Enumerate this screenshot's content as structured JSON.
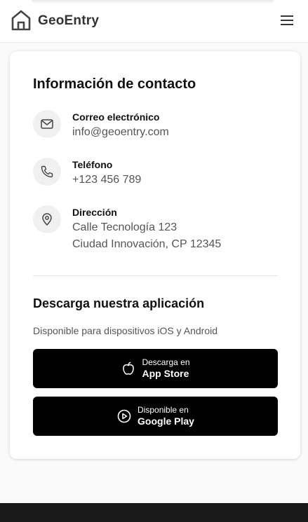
{
  "header": {
    "brand": "GeoEntry"
  },
  "contact": {
    "title": "Información de contacto",
    "email": {
      "label": "Correo electrónico",
      "value": "info@geoentry.com"
    },
    "phone": {
      "label": "Teléfono",
      "value": "+123 456 789"
    },
    "address": {
      "label": "Dirección",
      "line1": "Calle Tecnología 123",
      "line2": "Ciudad Innovación, CP 12345"
    }
  },
  "download": {
    "title": "Descarga nuestra aplicación",
    "description": "Disponible para dispositivos iOS y Android",
    "app_store": {
      "small": "Descarga en",
      "big": "App Store"
    },
    "google_play": {
      "small": "Disponible en",
      "big": "Google Play"
    }
  },
  "icons": {
    "logo": "house-icon",
    "menu": "hamburger-menu-icon",
    "email": "mail-icon",
    "phone": "phone-icon",
    "address": "map-pin-icon",
    "app_store": "apple-icon",
    "google_play": "play-icon"
  },
  "colors": {
    "button_bg": "#000000",
    "icon_circle_bg": "#f0f0f0",
    "footer_bg": "#1a1a1a"
  }
}
